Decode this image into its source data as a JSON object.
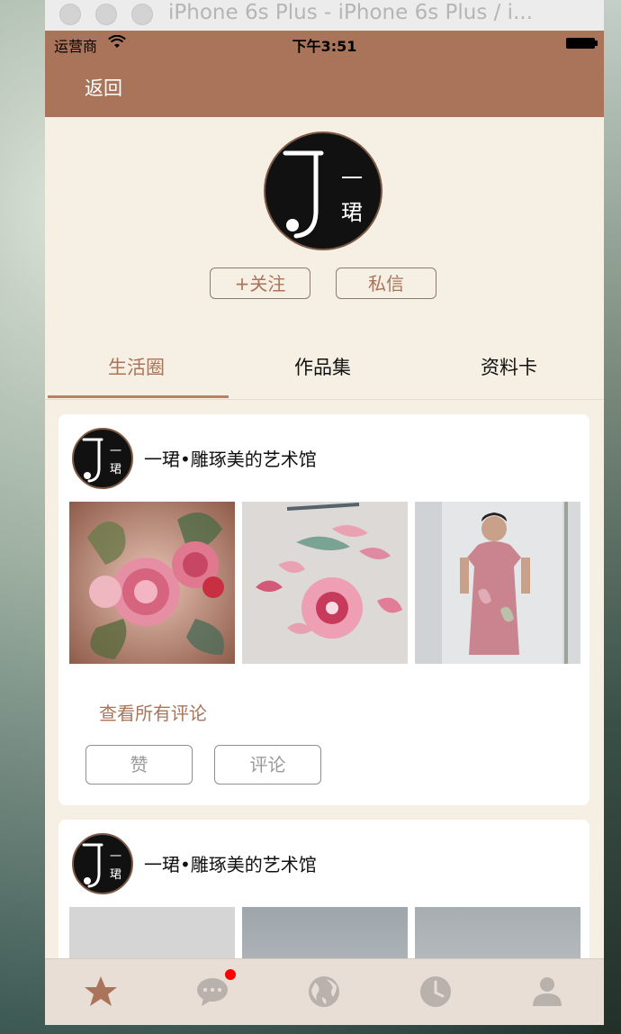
{
  "window": {
    "title": "iPhone 6s Plus - iPhone 6s Plus / i..."
  },
  "statusbar": {
    "carrier": "运营商",
    "time": "下午3:51"
  },
  "navbar": {
    "back_label": "返回"
  },
  "profile": {
    "avatar_text_1": "一",
    "avatar_text_2": "珺",
    "follow_label": "+关注",
    "message_label": "私信"
  },
  "tabs": [
    {
      "label": "生活圈",
      "active": true
    },
    {
      "label": "作品集",
      "active": false
    },
    {
      "label": "资料卡",
      "active": false
    }
  ],
  "posts": [
    {
      "author": "一珺•雕琢美的艺术馆",
      "photos": [
        "peony-embroidery",
        "petal-embroidery",
        "qipao-dress"
      ],
      "see_comments": "查看所有评论",
      "like_label": "赞",
      "comment_label": "评论"
    },
    {
      "author": "一珺•雕琢美的艺术馆",
      "photos": [
        "gray-photo",
        "ceiling-photo",
        "ceiling-photo"
      ]
    }
  ],
  "tabbar": {
    "items": [
      "star-icon",
      "chat-icon",
      "globe-icon",
      "clock-icon",
      "person-icon"
    ],
    "active_color": "#a9745a",
    "inactive_color": "#b9b1ab",
    "badge_color": "#ff0000"
  }
}
